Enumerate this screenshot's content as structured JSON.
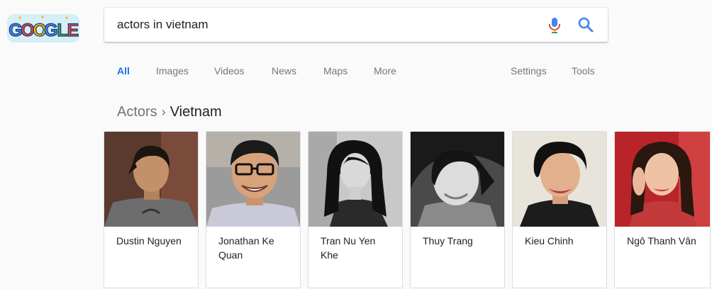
{
  "logo": {
    "text": "Google",
    "colors": [
      "#4285f4",
      "#ea4335",
      "#fbbc05",
      "#4285f4",
      "#34a853",
      "#ea4335"
    ]
  },
  "search": {
    "query": "actors in vietnam",
    "mic_icon": "microphone-icon",
    "search_icon": "magnifier-icon"
  },
  "tabs": [
    {
      "label": "All",
      "active": true
    },
    {
      "label": "Images"
    },
    {
      "label": "Videos"
    },
    {
      "label": "News"
    },
    {
      "label": "Maps"
    },
    {
      "label": "More"
    }
  ],
  "tools": [
    {
      "label": "Settings"
    },
    {
      "label": "Tools"
    }
  ],
  "breadcrumb": {
    "parent": "Actors",
    "separator": "›",
    "current": "Vietnam"
  },
  "cards": [
    {
      "name": "Dustin Nguyen",
      "photo": "color"
    },
    {
      "name": "Jonathan Ke Quan",
      "photo": "color"
    },
    {
      "name": "Tran Nu Yen Khe",
      "photo": "grayscale"
    },
    {
      "name": "Thuy Trang",
      "photo": "grayscale"
    },
    {
      "name": "Kieu Chinh",
      "photo": "color"
    },
    {
      "name": "Ngô Thanh Vân",
      "photo": "color"
    }
  ],
  "colors": {
    "accent": "#1a73e8",
    "muted": "#777777",
    "background": "#fafafa"
  }
}
